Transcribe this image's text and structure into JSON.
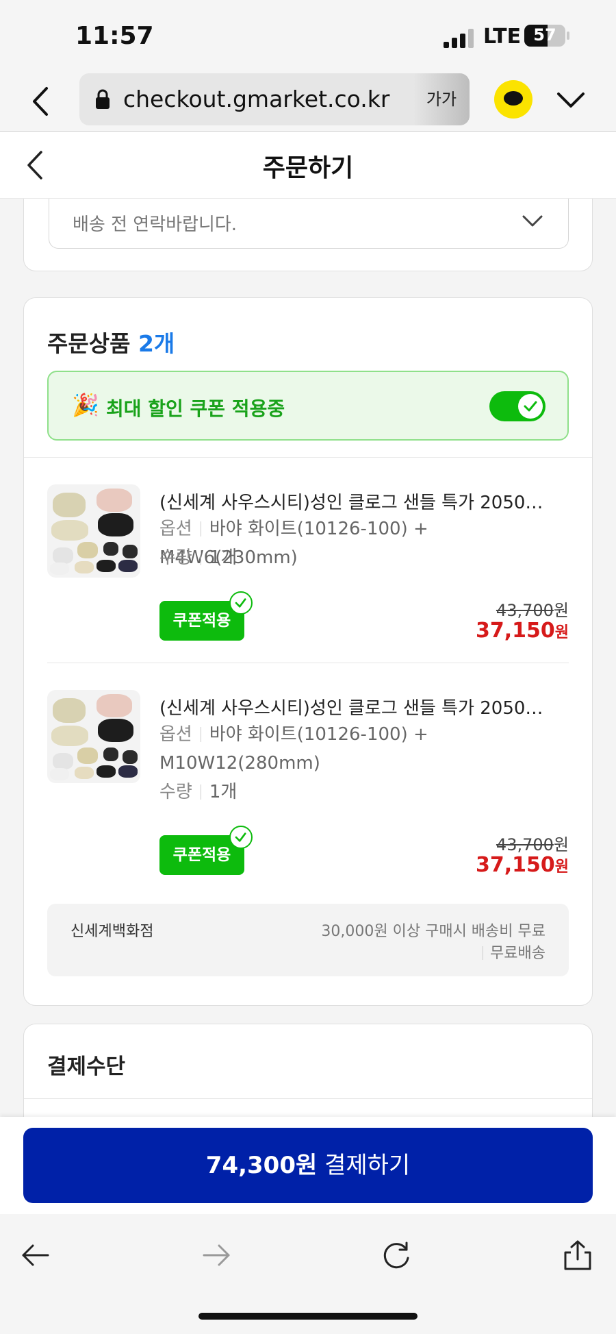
{
  "status_bar": {
    "time": "11:57",
    "network": "LTE",
    "battery": "57"
  },
  "browser": {
    "url": "checkout.gmarket.co.kr",
    "text_size_label": "가가"
  },
  "header": {
    "title": "주문하기"
  },
  "delivery_request": {
    "value": "배송 전 연락바랍니다."
  },
  "order_products": {
    "title": "주문상품",
    "count": "2개",
    "coupon_banner": {
      "label": "최대 할인 쿠폰 적용중",
      "toggle_on": true
    },
    "items": [
      {
        "name": "(신세계 사우스시티)성인 클로그 샌들 특가 2050…",
        "option_label": "옵션",
        "option_value": "바야 화이트(10126-100) + M4W6(230mm)",
        "qty_label": "수량",
        "qty_value": "1개",
        "coupon_badge": "쿠폰적용",
        "original_price": "43,700",
        "original_unit": "원",
        "sale_price": "37,150",
        "sale_unit": "원"
      },
      {
        "name": "(신세계 사우스시티)성인 클로그 샌들 특가 2050…",
        "option_label": "옵션",
        "option_value": "바야 화이트(10126-100) + M10W12(280mm)",
        "qty_label": "수량",
        "qty_value": "1개",
        "coupon_badge": "쿠폰적용",
        "original_price": "43,700",
        "original_unit": "원",
        "sale_price": "37,150",
        "sale_unit": "원"
      }
    ],
    "shipping": {
      "store": "신세계백화점",
      "policy": "30,000원 이상 구매시 배송비 무료",
      "fee": "무료배송"
    }
  },
  "payment_method": {
    "title": "결제수단"
  },
  "pay_button": {
    "amount": "74,300원",
    "label": " 결제하기"
  },
  "colors": {
    "accent_blue": "#0021a8",
    "coupon_green": "#0dbb0d",
    "sale_red": "#d61a1a",
    "count_blue": "#1a7ae8"
  }
}
